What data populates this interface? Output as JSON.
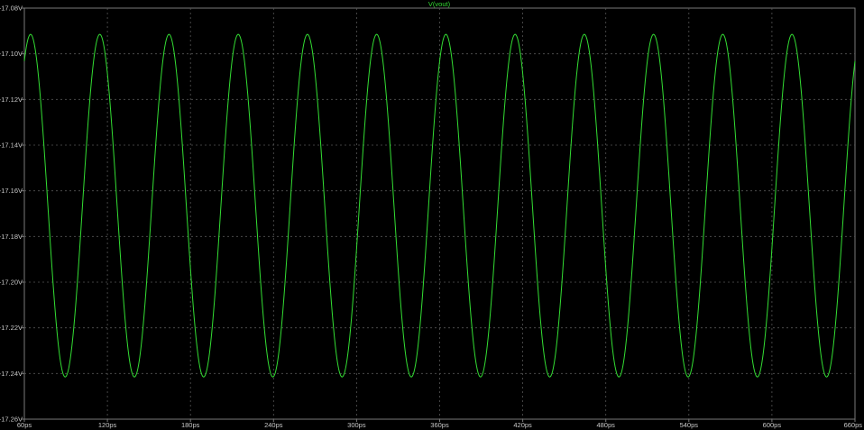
{
  "window": {
    "background": "#000000",
    "trace_color": "#33dd33",
    "grid_color": "#555555",
    "axis_label_color": "#c8c8c8"
  },
  "chart_data": {
    "type": "line",
    "title": "V(vout)",
    "xlabel": "",
    "ylabel": "",
    "grid": true,
    "x_unit": "ps",
    "y_unit": "V",
    "xlim": [
      60,
      660
    ],
    "ylim": [
      -17.26,
      -17.08
    ],
    "x_ticks": [
      "60ps",
      "120ps",
      "180ps",
      "240ps",
      "300ps",
      "360ps",
      "420ps",
      "480ps",
      "540ps",
      "600ps",
      "660ps"
    ],
    "y_ticks": [
      "-17.08V",
      "-17.10V",
      "-17.12V",
      "-17.14V",
      "-17.16V",
      "-17.18V",
      "-17.20V",
      "-17.22V",
      "-17.24V",
      "-17.26V"
    ],
    "series": [
      {
        "name": "V(vout)",
        "color": "#33dd33",
        "waveform": "sine",
        "period_ps": 50,
        "first_peak_ps": 64.5,
        "max": -17.0915,
        "min": -17.2415,
        "x_start": 60,
        "x_end": 660
      }
    ]
  }
}
